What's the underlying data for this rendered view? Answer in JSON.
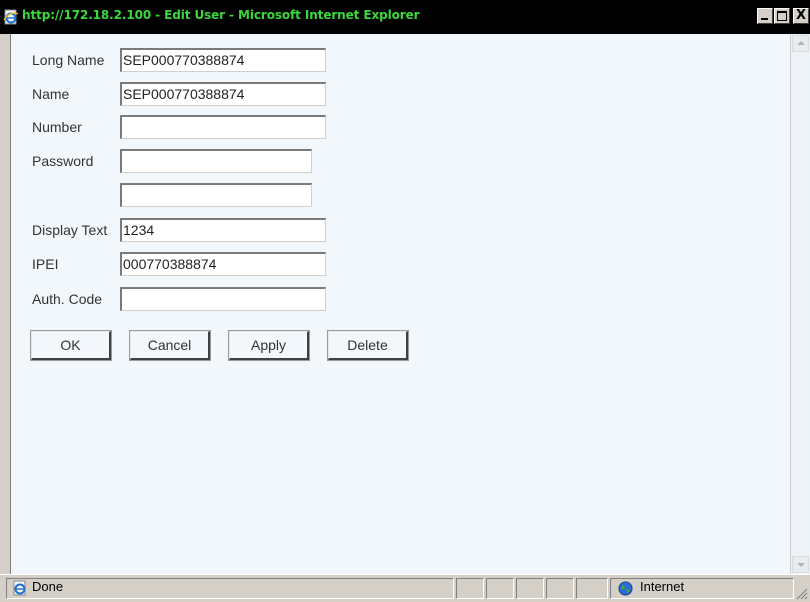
{
  "window": {
    "title": "http://172.18.2.100 - Edit User - Microsoft Internet Explorer",
    "title_color": "#3ad93a",
    "close_glyph": "X",
    "icons": {
      "title": "ie-page-icon",
      "minimize": "minimize-icon",
      "maximize": "maximize-icon",
      "close": "close-icon"
    }
  },
  "form": {
    "long_name": {
      "label": "Long Name",
      "value": "SEP000770388874"
    },
    "name": {
      "label": "Name",
      "value": "SEP000770388874"
    },
    "number": {
      "label": "Number",
      "value": ""
    },
    "password": {
      "label": "Password",
      "value": "",
      "confirm_value": ""
    },
    "display_text": {
      "label": "Display Text",
      "value": "1234"
    },
    "ipei": {
      "label": "IPEI",
      "value": "000770388874"
    },
    "auth_code": {
      "label": "Auth. Code",
      "value": ""
    }
  },
  "buttons": {
    "ok": "OK",
    "cancel": "Cancel",
    "apply": "Apply",
    "delete": "Delete"
  },
  "statusbar": {
    "status": "Done",
    "zone": "Internet",
    "icons": {
      "status": "ie-page-icon",
      "zone": "internet-globe-icon"
    }
  },
  "colors": {
    "page_background": "#f2f7fb",
    "chrome": "#d4d0c8",
    "titlebar": "#000000"
  }
}
